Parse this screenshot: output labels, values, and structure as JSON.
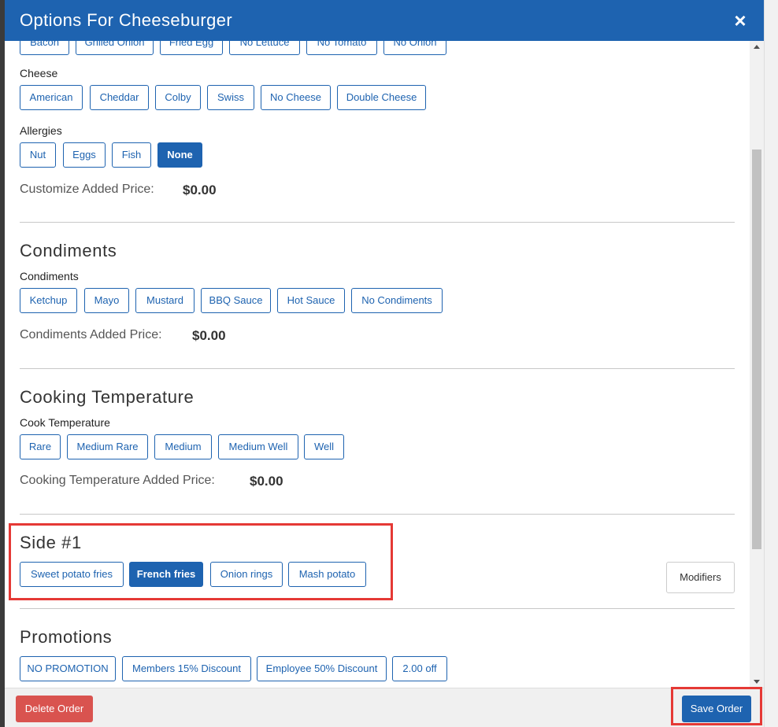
{
  "header": {
    "title": "Options For Cheeseburger",
    "close_symbol": "×"
  },
  "toppings": {
    "partial_options": [
      "Bacon",
      "Grilled Onion",
      "Fried Egg",
      "No Lettuce",
      "No Tomato",
      "No Onion"
    ]
  },
  "cheese": {
    "label": "Cheese",
    "options": [
      "American",
      "Cheddar",
      "Colby",
      "Swiss",
      "No Cheese",
      "Double Cheese"
    ]
  },
  "allergies": {
    "label": "Allergies",
    "options": [
      "Nut",
      "Eggs",
      "Fish",
      "None"
    ],
    "selected": "None"
  },
  "customize": {
    "price_label": "Customize Added Price:",
    "price_value": "$0.00"
  },
  "condiments": {
    "title": "Condiments",
    "label": "Condiments",
    "options": [
      "Ketchup",
      "Mayo",
      "Mustard",
      "BBQ Sauce",
      "Hot Sauce",
      "No Condiments"
    ],
    "price_label": "Condiments Added Price:",
    "price_value": "$0.00"
  },
  "cooking": {
    "title": "Cooking Temperature",
    "label": "Cook Temperature",
    "options": [
      "Rare",
      "Medium Rare",
      "Medium",
      "Medium Well",
      "Well"
    ],
    "price_label": "Cooking Temperature Added Price:",
    "price_value": "$0.00"
  },
  "side": {
    "title": "Side #1",
    "options": [
      "Sweet potato fries",
      "French fries",
      "Onion rings",
      "Mash potato"
    ],
    "selected": "French fries",
    "modifiers_label": "Modifiers"
  },
  "promotions": {
    "title": "Promotions",
    "options": [
      "NO PROMOTION",
      "Members 15% Discount",
      "Employee 50% Discount",
      "2.00 off"
    ]
  },
  "footer": {
    "delete_label": "Delete Order",
    "save_label": "Save Order"
  },
  "colors": {
    "primary": "#1e63b0",
    "danger": "#d9534f",
    "highlight": "#e53935"
  }
}
